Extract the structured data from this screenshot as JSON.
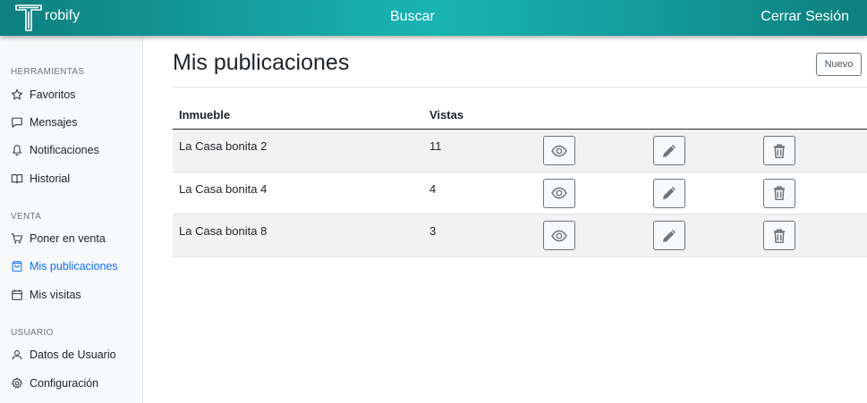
{
  "navbar": {
    "brand_text": "robify",
    "search_label": "Buscar",
    "logout_label": "Cerrar Sesión"
  },
  "sidebar": {
    "sections": [
      {
        "heading": "HERRAMIENTAS",
        "items": [
          {
            "label": "Favoritos",
            "icon": "star-icon"
          },
          {
            "label": "Mensajes",
            "icon": "message-icon"
          },
          {
            "label": "Notificaciones",
            "icon": "bell-icon"
          },
          {
            "label": "Historial",
            "icon": "book-icon"
          }
        ]
      },
      {
        "heading": "VENTA",
        "items": [
          {
            "label": "Poner en venta",
            "icon": "cart-icon"
          },
          {
            "label": "Mis publicaciones",
            "icon": "bag-icon",
            "active": true
          },
          {
            "label": "Mis visitas",
            "icon": "calendar-icon"
          }
        ]
      },
      {
        "heading": "USUARIO",
        "items": [
          {
            "label": "Datos de Usuario",
            "icon": "user-icon"
          },
          {
            "label": "Configuración",
            "icon": "gear-icon"
          }
        ]
      }
    ]
  },
  "main": {
    "title": "Mis publicaciones",
    "new_button_label": "Nuevo",
    "table": {
      "columns": [
        "Inmueble",
        "Vistas"
      ],
      "rows": [
        {
          "inmueble": "La Casa bonita 2",
          "vistas": "11"
        },
        {
          "inmueble": "La Casa bonita 4",
          "vistas": "4"
        },
        {
          "inmueble": "La Casa bonita 8",
          "vistas": "3"
        }
      ],
      "row_actions": [
        "eye-icon",
        "pencil-icon",
        "trash-icon"
      ]
    }
  },
  "colors": {
    "navbar_teal": "#139a9a",
    "active_link": "#0d6efd",
    "action_icon": "#6c757d"
  }
}
